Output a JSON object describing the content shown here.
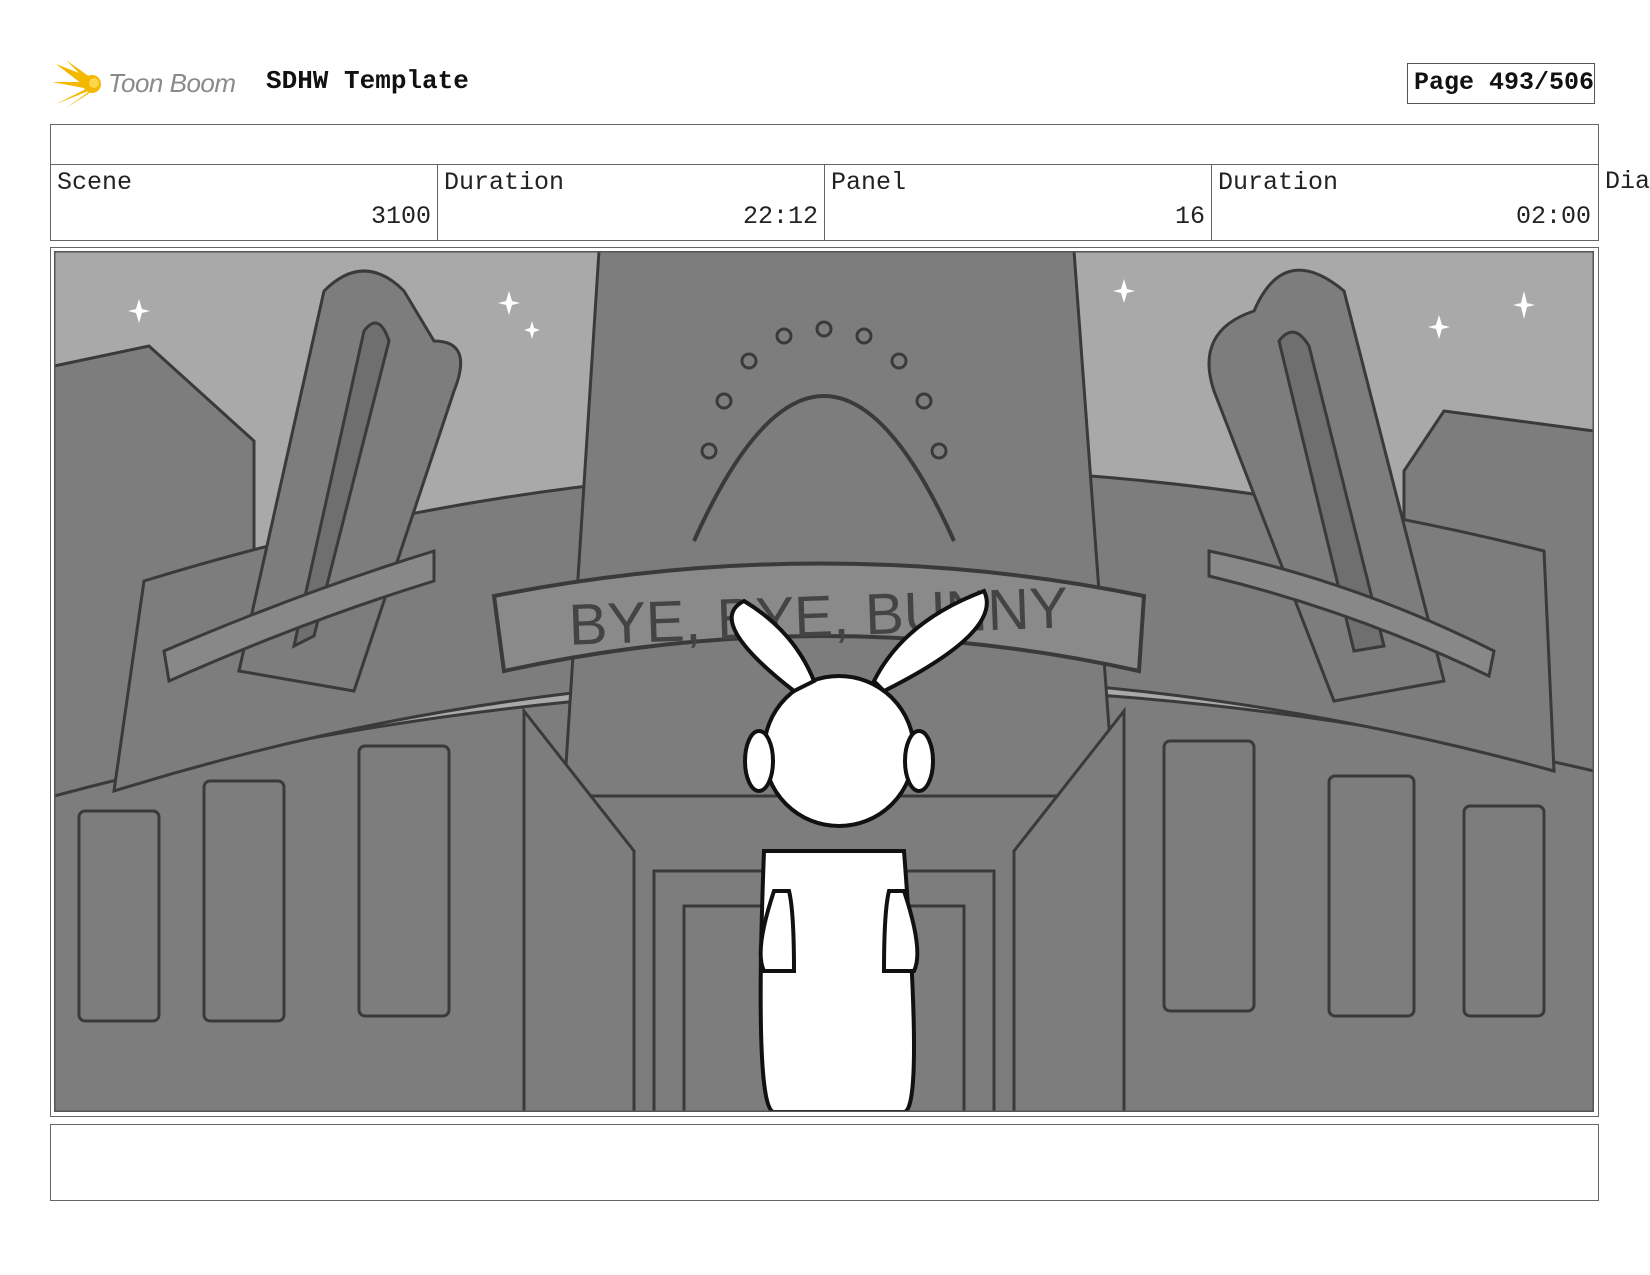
{
  "header": {
    "logo_text": "Toon Boom",
    "title": "SDHW Template",
    "page_label": "Page 493/506"
  },
  "fields": [
    {
      "label": "Scene",
      "value": "3100"
    },
    {
      "label": "Duration",
      "value": "22:12"
    },
    {
      "label": "Panel",
      "value": "16"
    },
    {
      "label": "Duration",
      "value": "02:00"
    }
  ],
  "overflow_label": "Dia",
  "panel": {
    "marquee_text": "BYE, BYE, BUNNY",
    "palette": {
      "sky": "#a9a9a9",
      "building": "#7d7d7d",
      "line": "#3a3a3a",
      "figure": "#ffffff"
    }
  },
  "logo_colors": {
    "burst": "#f5b800",
    "text": "#8a8a8a"
  }
}
